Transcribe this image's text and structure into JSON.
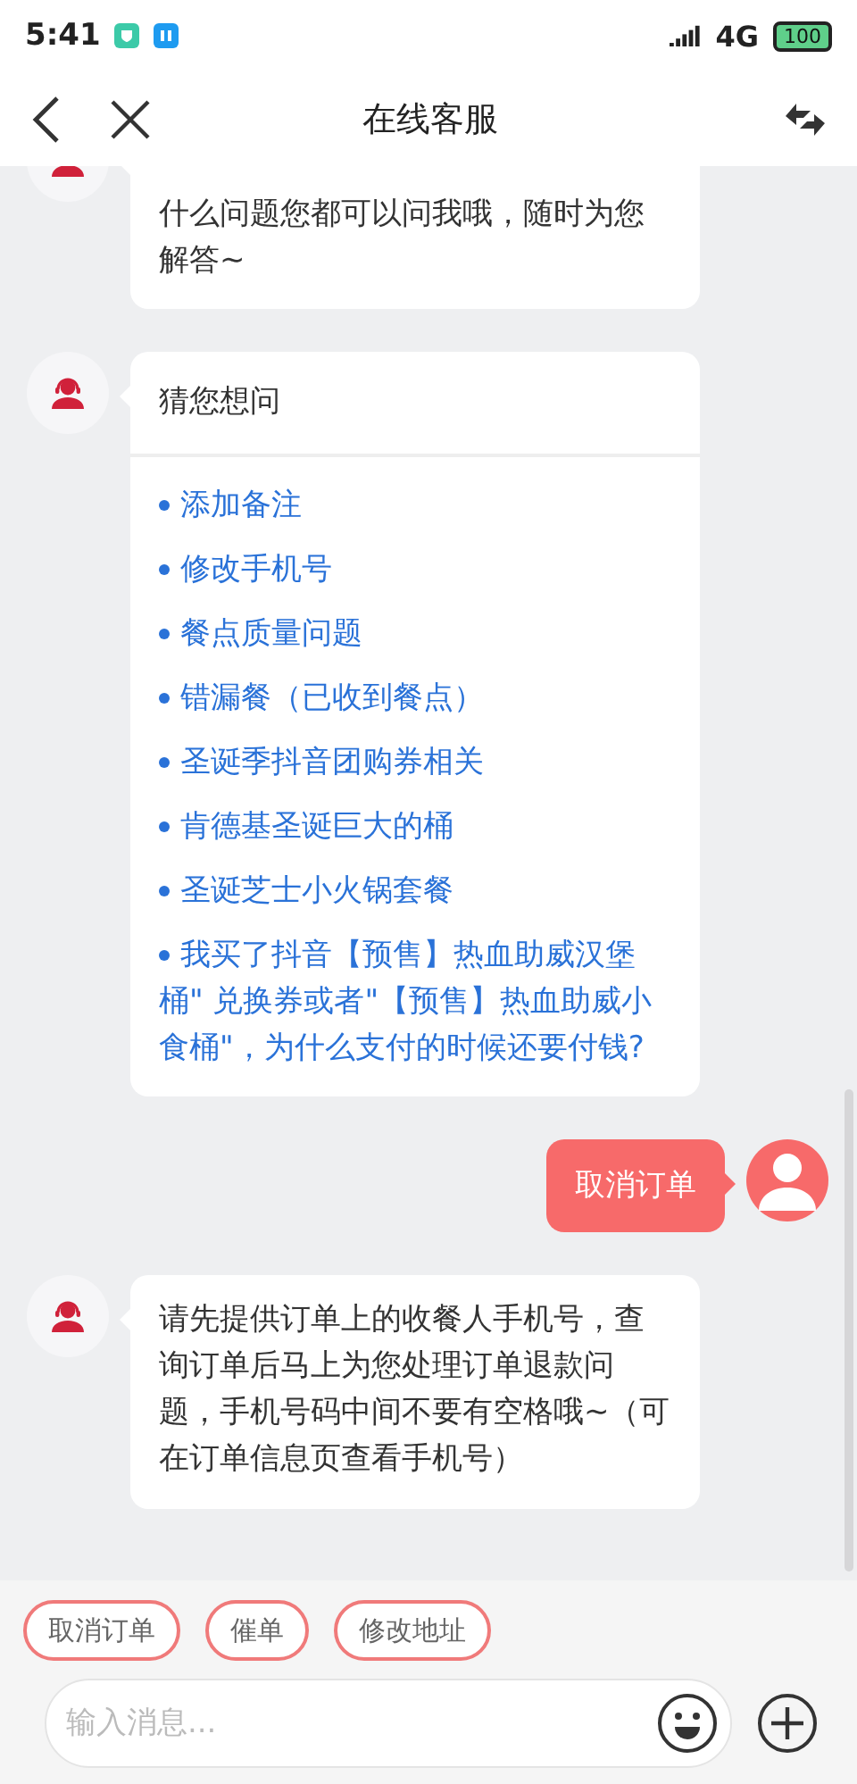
{
  "status_bar": {
    "time": "5:41",
    "network": "4G",
    "battery": "100"
  },
  "header": {
    "title": "在线客服"
  },
  "messages": [
    {
      "kind": "bot_text",
      "text": "什么问题您都可以问我哦，随时为您解答~"
    },
    {
      "kind": "bot_suggestions",
      "title": "猜您想问",
      "items": [
        "添加备注",
        "修改手机号",
        "餐点质量问题",
        "错漏餐（已收到餐点）",
        "圣诞季抖音团购券相关",
        "肯德基圣诞巨大的桶",
        "圣诞芝士小火锅套餐",
        "我买了抖音【预售】热血助威汉堡桶\" 兑换券或者\"【预售】热血助威小食桶\"，为什么支付的时候还要付钱?"
      ]
    },
    {
      "kind": "user_text",
      "text": "取消订单"
    },
    {
      "kind": "bot_text",
      "text": "请先提供订单上的收餐人手机号，查询订单后马上为您处理订单退款问题，手机号码中间不要有空格哦~（可在订单信息页查看手机号）"
    }
  ],
  "quick_replies": [
    "取消订单",
    "催单",
    "修改地址"
  ],
  "input": {
    "placeholder": "输入消息..."
  }
}
